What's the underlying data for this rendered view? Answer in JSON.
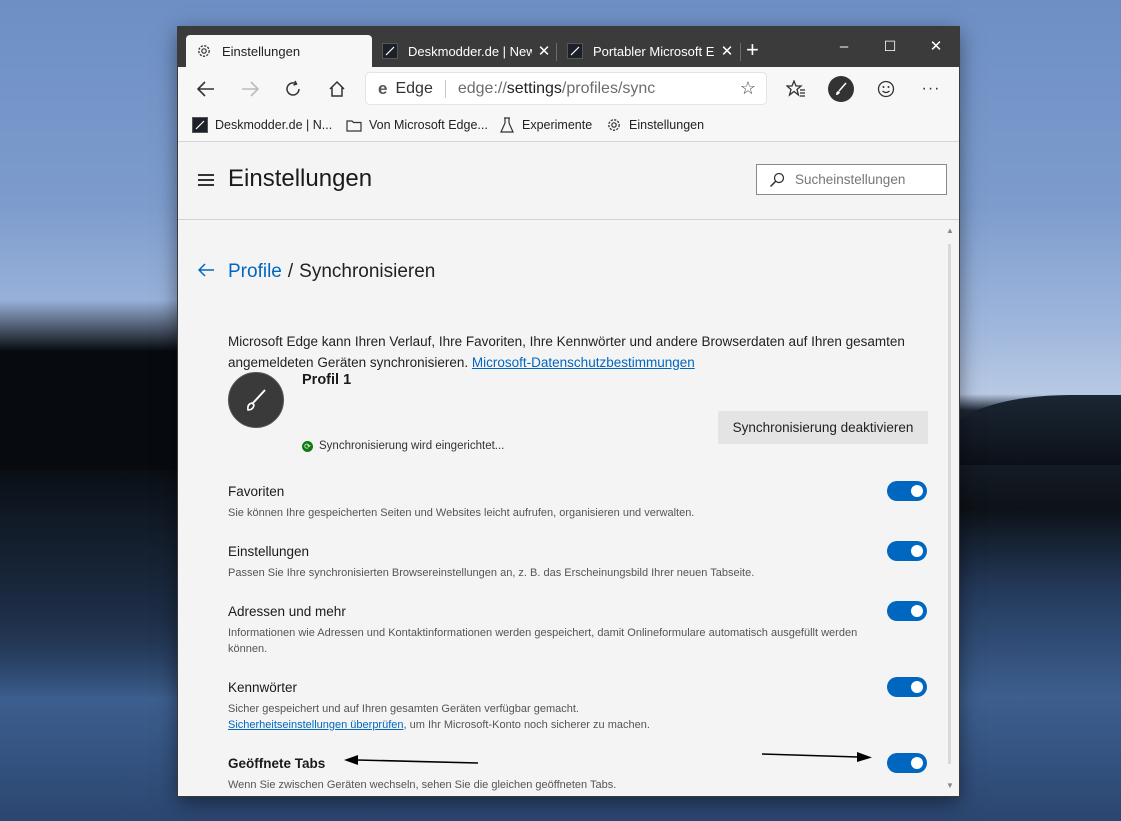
{
  "tabs": [
    {
      "label": "Einstellungen",
      "icon": "gear-icon",
      "active": true
    },
    {
      "label": "Deskmodder.de | News",
      "icon": "deskmodder-icon",
      "active": false
    },
    {
      "label": "Portabler Microsoft Edge",
      "icon": "deskmodder-icon",
      "active": false
    }
  ],
  "window_controls": {
    "minimize": "–",
    "maximize": "☐",
    "close": "✕"
  },
  "address": {
    "site_label": "Edge",
    "url_prefix": "edge://",
    "url_host": "settings",
    "url_path": "/profiles/sync"
  },
  "bookmarks": [
    {
      "label": "Deskmodder.de | N...",
      "icon": "deskmodder-icon"
    },
    {
      "label": "Von Microsoft Edge...",
      "icon": "folder-icon"
    },
    {
      "label": "Experimente",
      "icon": "flask-icon"
    },
    {
      "label": "Einstellungen",
      "icon": "gear-icon"
    }
  ],
  "header": {
    "title": "Einstellungen",
    "search_placeholder": "Sucheinstellungen"
  },
  "breadcrumb": {
    "parent": "Profile",
    "separator": "/",
    "current": "Synchronisieren"
  },
  "intro": {
    "text": "Microsoft Edge kann Ihren Verlauf, Ihre Favoriten, Ihre Kennwörter und andere Browserdaten auf Ihren gesamten angemeldeten Geräten synchronisieren. ",
    "link": "Microsoft-Datenschutzbestimmungen"
  },
  "profile": {
    "name": "Profil 1",
    "status": "Synchronisierung wird eingerichtet...",
    "deactivate_label": "Synchronisierung deaktivieren"
  },
  "sync_items": [
    {
      "title": "Favoriten",
      "desc": "Sie können Ihre gespeicherten Seiten und Websites leicht aufrufen, organisieren und verwalten.",
      "enabled": true
    },
    {
      "title": "Einstellungen",
      "desc": "Passen Sie Ihre synchronisierten Browsereinstellungen an, z. B. das Erscheinungsbild Ihrer neuen Tabseite.",
      "enabled": true
    },
    {
      "title": "Adressen und mehr",
      "desc": "Informationen wie Adressen und Kontaktinformationen werden gespeichert, damit Onlineformulare automatisch ausgefüllt werden können.",
      "enabled": true
    },
    {
      "title": "Kennwörter",
      "desc": "Sicher gespeichert und auf Ihren gesamten Geräten verfügbar gemacht.",
      "desc_link": "Sicherheitseinstellungen überprüfen",
      "desc_after": ", um Ihr Microsoft-Konto noch sicherer zu machen.",
      "enabled": true
    },
    {
      "title": "Geöffnete Tabs",
      "desc": "Wenn Sie zwischen Geräten wechseln, sehen Sie die gleichen geöffneten Tabs.",
      "enabled": true
    }
  ],
  "colors": {
    "accent": "#0067c0",
    "sync_ok": "#107c10"
  }
}
